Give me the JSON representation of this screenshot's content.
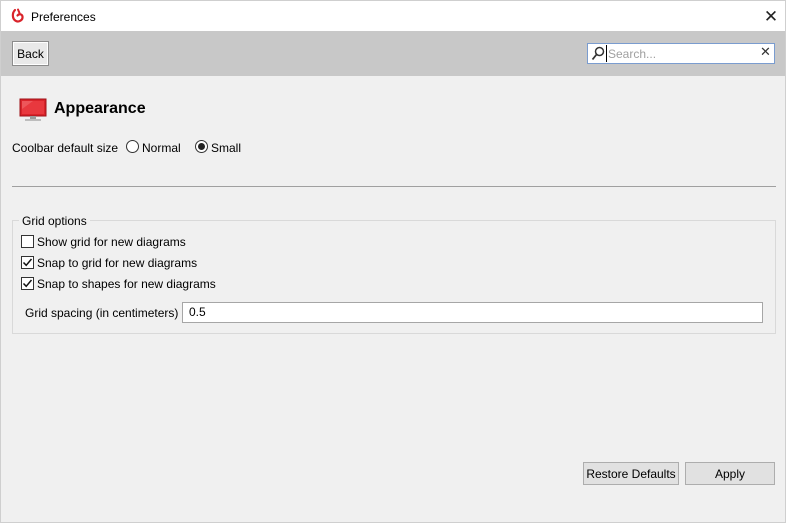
{
  "window": {
    "title": "Preferences",
    "close_glyph": "✕"
  },
  "toolbar": {
    "back_label": "Back",
    "search_placeholder": "Search...",
    "search_value": "",
    "clear_glyph": "✕"
  },
  "page": {
    "title": "Appearance",
    "icon": "monitor-icon",
    "accent_color": "#d9232a"
  },
  "coolbar": {
    "label": "Coolbar default size",
    "options": [
      {
        "label": "Normal",
        "selected": false
      },
      {
        "label": "Small",
        "selected": true
      }
    ]
  },
  "grid_options": {
    "legend": "Grid options",
    "checkboxes": [
      {
        "label": "Show grid for new diagrams",
        "checked": false
      },
      {
        "label": "Snap to grid for new diagrams",
        "checked": true
      },
      {
        "label": "Snap to shapes for new diagrams",
        "checked": true
      }
    ],
    "spacing_label": "Grid spacing (in centimeters)",
    "spacing_value": "0.5"
  },
  "actions": {
    "restore_label": "Restore Defaults",
    "apply_label": "Apply"
  }
}
